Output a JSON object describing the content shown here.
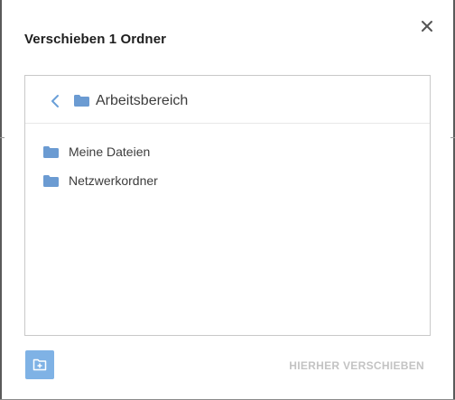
{
  "dialog": {
    "title": "Verschieben 1 Ordner",
    "close_icon": "close-icon"
  },
  "browser": {
    "current_folder": "Arbeitsbereich",
    "back_icon": "chevron-left-icon",
    "folder_icon": "folder-icon",
    "items": [
      {
        "label": "Meine Dateien"
      },
      {
        "label": "Netzwerkordner"
      }
    ]
  },
  "footer": {
    "new_folder_icon": "new-folder-icon",
    "move_here_label": "HIERHER VERSCHIEBEN"
  },
  "colors": {
    "accent": "#6a9fd8",
    "folder": "#6b9bd2",
    "button_bg": "#7fb2e5",
    "disabled_text": "#c3c3c3"
  }
}
